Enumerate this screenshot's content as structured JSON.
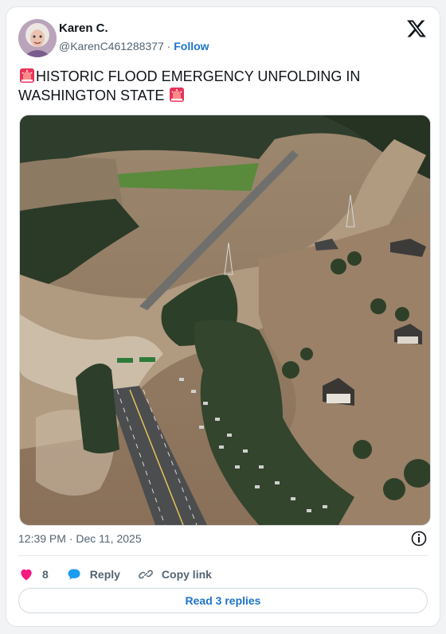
{
  "tweet": {
    "author_name": "Karen C.",
    "author_handle": "@KarenC461288377",
    "separator": " · ",
    "follow_label": "Follow",
    "text": "HISTORIC FLOOD EMERGENCY UNFOLDING IN WASHINGTON STATE",
    "leading_emoji": "siren-icon",
    "trailing_emoji": "siren-icon",
    "timestamp": "12:39 PM · Dec 11, 2025",
    "like_count": "8",
    "reply_label": "Reply",
    "copy_link_label": "Copy link",
    "read_replies_label": "Read 3 replies"
  },
  "colors": {
    "link_blue": "#1d74c9",
    "like_pink": "#f91880",
    "reply_blue": "#1d9bf0",
    "text_dark": "#0f1419",
    "text_muted": "#536471"
  }
}
